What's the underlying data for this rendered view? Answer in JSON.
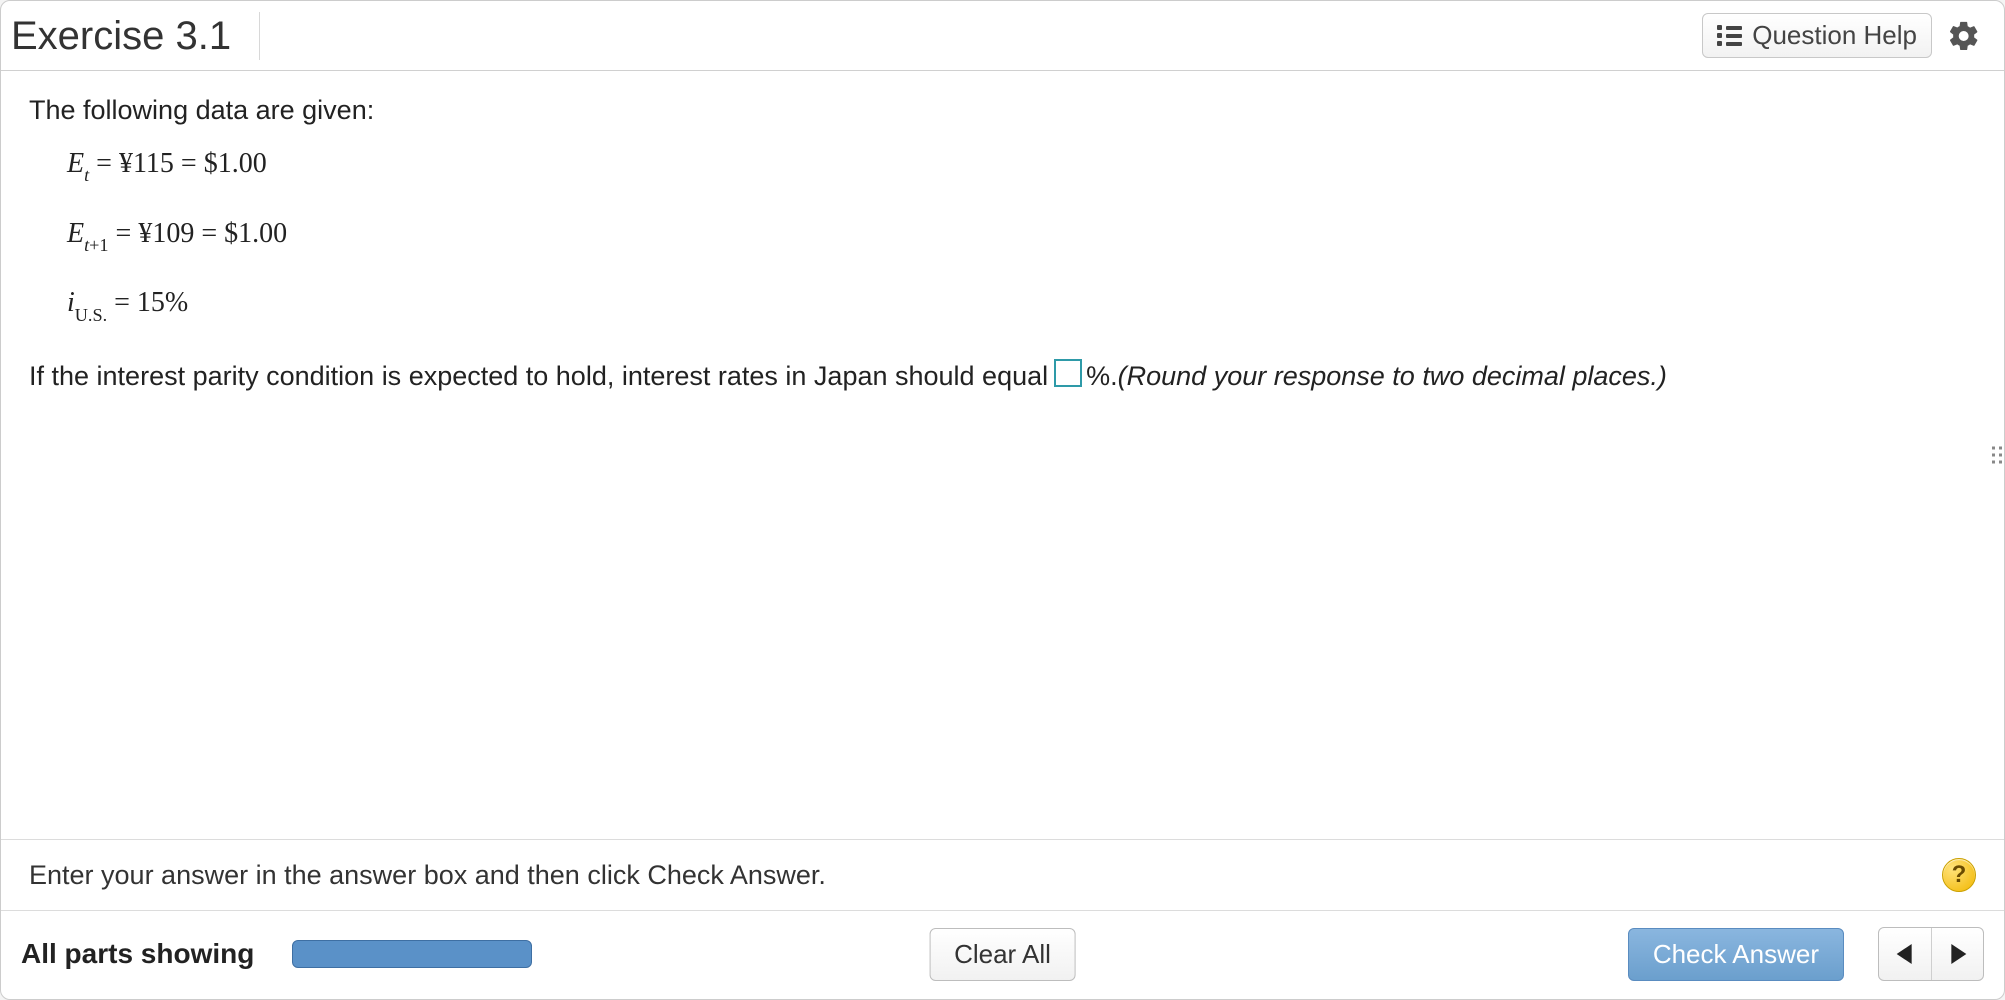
{
  "header": {
    "title": "Exercise 3.1",
    "question_help_label": "Question Help"
  },
  "content": {
    "intro": "The following data are given:",
    "et_value": " = ¥115 = $1.00",
    "et1_value": " = ¥109 = $1.00",
    "ius_value": " = 15%",
    "q_prefix": "If the interest parity condition is expected to hold, interest rates in Japan should equal ",
    "q_suffix_unit": "%. ",
    "q_hint": "(Round your response to two decimal places.)"
  },
  "instruction": {
    "text": "Enter your answer in the answer box and then click Check Answer.",
    "help_symbol": "?"
  },
  "footer": {
    "parts_label": "All parts showing",
    "clear_all": "Clear All",
    "check_answer": "Check Answer"
  }
}
